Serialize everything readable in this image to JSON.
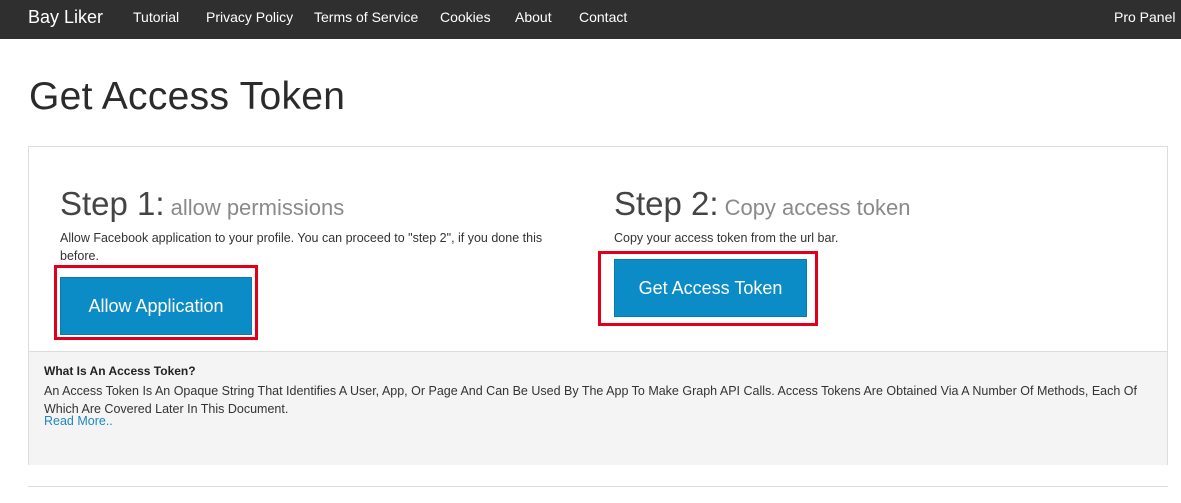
{
  "navbar": {
    "brand": "Bay Liker",
    "items": [
      {
        "label": "Tutorial"
      },
      {
        "label": "Privacy Policy"
      },
      {
        "label": "Terms of Service"
      },
      {
        "label": "Cookies"
      },
      {
        "label": "About"
      },
      {
        "label": "Contact"
      }
    ],
    "right_item": "Pro Panel",
    "background_color": "#2f2f2f"
  },
  "page": {
    "title": "Get Access Token"
  },
  "step1": {
    "number": "Step 1:",
    "subtitle": "allow permissions",
    "description": "Allow Facebook application to your profile. You can proceed to \"step 2\", if you done this before.",
    "button_label": "Allow Application"
  },
  "step2": {
    "number": "Step 2:",
    "subtitle": "Copy access token",
    "description": "Copy your access token from the url bar.",
    "button_label": "Get Access Token"
  },
  "info": {
    "title": "What Is An Access Token?",
    "text": "An Access Token Is An Opaque String That Identifies A User, App, Or Page And Can Be Used By The App To Make Graph API Calls. Access Tokens Are Obtained Via A Number Of Methods, Each Of Which Are Covered Later In This Document.",
    "link_label": "Read More.."
  },
  "colors": {
    "button": "#0c8cc6",
    "highlight": "#e0001b",
    "link": "#1f86c4"
  }
}
